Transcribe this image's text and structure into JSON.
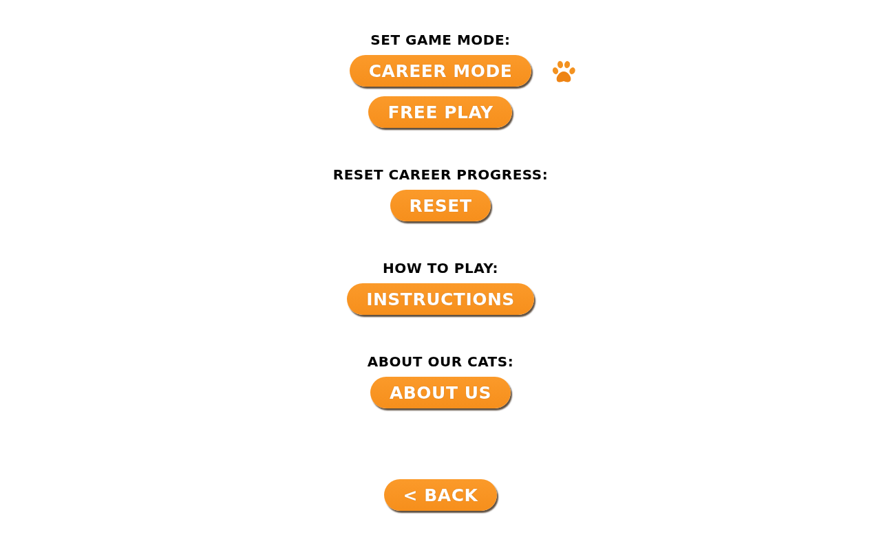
{
  "sections": [
    {
      "heading": "SET GAME MODE:",
      "buttons": [
        {
          "label": "CAREER MODE",
          "selected": true
        },
        {
          "label": "FREE PLAY",
          "selected": false
        }
      ]
    },
    {
      "heading": "RESET CAREER PROGRESS:",
      "buttons": [
        {
          "label": "RESET"
        }
      ]
    },
    {
      "heading": "HOW TO PLAY:",
      "buttons": [
        {
          "label": "INSTRUCTIONS"
        }
      ]
    },
    {
      "heading": "ABOUT OUR CATS:",
      "buttons": [
        {
          "label": "ABOUT US"
        }
      ]
    }
  ],
  "back_button": {
    "label": "< BACK"
  }
}
